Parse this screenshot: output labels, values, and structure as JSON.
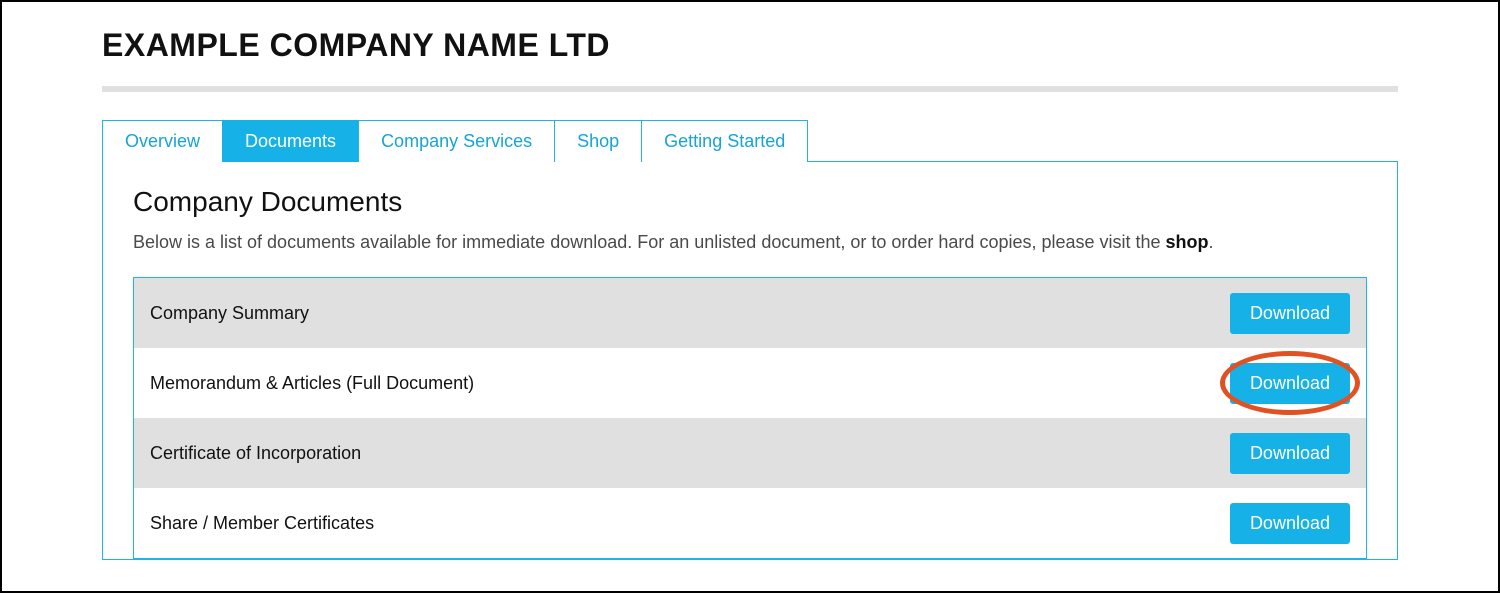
{
  "company_name": "EXAMPLE COMPANY NAME LTD",
  "tabs": [
    {
      "label": "Overview",
      "active": false
    },
    {
      "label": "Documents",
      "active": true
    },
    {
      "label": "Company Services",
      "active": false
    },
    {
      "label": "Shop",
      "active": false
    },
    {
      "label": "Getting Started",
      "active": false
    }
  ],
  "panel": {
    "title": "Company Documents",
    "desc_prefix": "Below is a list of documents available for immediate download. For an unlisted document, or to order hard copies, please visit the ",
    "shop_link": "shop",
    "desc_suffix": "."
  },
  "download_label": "Download",
  "documents": [
    {
      "name": "Company Summary",
      "highlighted": false
    },
    {
      "name": "Memorandum & Articles (Full Document)",
      "highlighted": true
    },
    {
      "name": "Certificate of Incorporation",
      "highlighted": false
    },
    {
      "name": "Share / Member Certificates",
      "highlighted": false
    }
  ]
}
